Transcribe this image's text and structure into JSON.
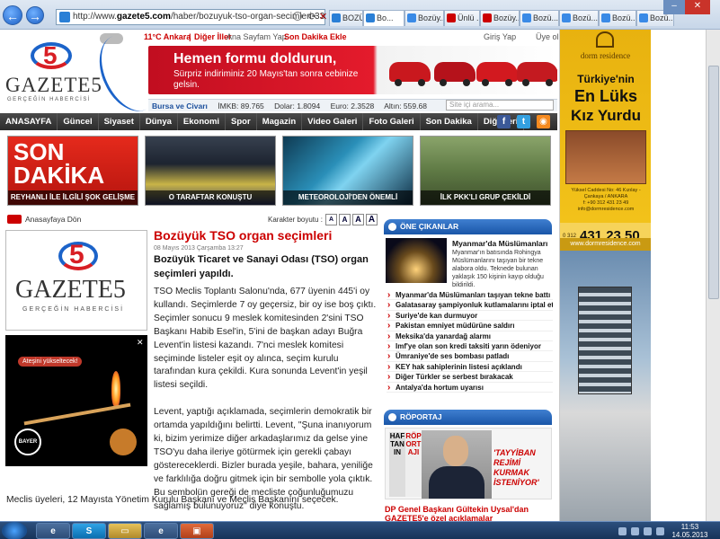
{
  "browser": {
    "url_prefix": "http://www.",
    "url_domain": "gazete5.com",
    "url_path": "/haber/bozuyuk-tso-organ-secimleri-330603.h",
    "tabs": [
      "BOZÜ...",
      "Bo...",
      "Bozüy...",
      "Ünlü ...",
      "Bozüy...",
      "Bozü...",
      "Bozü...",
      "Bozü...",
      "Bozü..."
    ],
    "nav_back_icon": "arrow-left-icon",
    "nav_forward_icon": "arrow-right-icon"
  },
  "topbar": {
    "weather": "11°C Ankara",
    "other_cities": "Diğer İller",
    "home_link": "Ana Sayfam Yap",
    "add_breaking": "Son Dakika Ekle",
    "login": "Giriş Yap",
    "register": "Üye ol"
  },
  "logo": {
    "number": "5",
    "name": "GAZETE5",
    "slogan": "GERÇEĞİN HABERCİSİ"
  },
  "banner": {
    "headline": "Hemen formu doldurun,",
    "subline": "Sürpriz indiriminiz 20 Mayıs'tan sonra cebinize gelsin."
  },
  "markets": {
    "weather_label": "Bursa ve Civarı",
    "imkb": "İMKB: 89.765",
    "dolar": "Dolar: 1.8094",
    "euro": "Euro: 2.3528",
    "altin": "Altın: 559.68",
    "search_placeholder": "Site içi arama..."
  },
  "nav": {
    "items": [
      "ANASAYFA",
      "Güncel",
      "Siyaset",
      "Dünya",
      "Ekonomi",
      "Spor",
      "Magazin",
      "Video Galeri",
      "Foto Galeri",
      "Son Dakika",
      "Diğerleri"
    ]
  },
  "headlines": [
    {
      "caption": "REYHANLI İLE İLGİLİ ŞOK GELİŞME",
      "big": "SON DAKİKA"
    },
    {
      "caption": "O TARAFTAR KONUŞTU"
    },
    {
      "caption": "METEOROLOJİ'DEN ÖNEMLİ"
    },
    {
      "caption": "İLK PKK'LI GRUP ÇEKİLDİ"
    }
  ],
  "article": {
    "back_label": "Anasayfaya Dön",
    "font_size_label": "Karakter boyutu :",
    "font_sizes": [
      "A",
      "A",
      "A",
      "A"
    ],
    "title": "Bozüyük TSO organ seçimleri",
    "date": "08 Mayıs 2013 Çarşamba 13:27",
    "lead": "Bozüyük Ticaret ve Sanayi Odası (TSO) organ seçimleri yapıldı.",
    "p1": "TSO Meclis Toplantı Salonu'nda, 677 üyenin 445'i oy kullandı. Seçimlerde 7 oy geçersiz, bir oy ise boş çıktı. Seçimler sonucu 9 meslek komitesinden 2'sini TSO Başkanı Habib Esel'in, 5'ini de başkan adayı Buğra Levent'in listesi kazandı. 7'nci meslek komitesi seçiminde listeler eşit oy alınca, seçim kurulu tarafından kura çekildi. Kura sonunda Levent'in yeşil listesi seçildi.",
    "p2": "Levent, yaptığı açıklamada, seçimlerin demokratik bir ortamda yapıldığını belirtti. Levent, \"Şuna inanıyorum ki, bizim yerimize diğer arkadaşlarımız da gelse yine TSO'yu daha ileriye götürmek için gerekli çabayı göstereceklerdi. Bizler burada yeşile, bahara, yeniliğe ve farklılığa doğru gitmek için bir sembolle yola çıktık. Bu sembolün gereği de mecliste çoğunluğumuzu sağlamış bulunuyoruz\" diye konuştu.",
    "p3": "Meclis üyeleri, 12 Mayısta Yönetim Kurulu Başkanı ve Meclis Başkanını seçecek."
  },
  "ad_left": {
    "badge": "Ateşini yükseltecek!",
    "brand": "BAYER"
  },
  "one_cikanlar": {
    "header": "ÖNE ÇIKANLAR",
    "feature_title": "Myanmar'da Müslümanları",
    "feature_desc": "Myanmar'ın batısında Rohingya Müslümanlarını taşıyan bir tekne alabora oldu. Teknede bulunan yaklaşık 150 kişinin kayıp olduğu bildirildi.",
    "items": [
      "Myanmar'da Müslümanları taşıyan tekne battı",
      "Galatasaray şampiyonluk kutlamalarını iptal etti",
      "Suriye'de kan durmuyor",
      "Pakistan emniyet müdürüne saldırı",
      "Meksika'da yanardağ alarmı",
      "Imf'ye olan son kredi taksiti yarın ödeniyor",
      "Ümraniye'de ses bombası patladı",
      "KEY hak sahiplerinin listesi açıklandı",
      "Diğer Türkler se serbest bırakacak",
      "Antalya'da hortum uyarısı"
    ]
  },
  "roportaj": {
    "header": "RÖPORTAJ",
    "vertical_a": "HAFTANIN",
    "vertical_b": "RÖPORTAJI",
    "quote": "'TAYYİBAN REJİMİ KURMAK İSTENİYOR'",
    "caption": "DP Genel Başkanı Gültekin Uysal'dan GAZETE5'e özel açıklamalar"
  },
  "side_ad": {
    "brand": "dorm residence",
    "line1": "Türkiye'nin",
    "line2": "En Lüks",
    "line3": "Kız Yurdu",
    "address": "Yüksel Caddesi No: 46 Kızılay - Çankaya / ANKARA",
    "fax": "f: +90 312 431 23 49",
    "email": "info@dormresidence.com",
    "phone_prefix": "0 312",
    "phone": "431 23 50",
    "web": "www.dormresidence.com"
  },
  "taskbar": {
    "time": "11:53",
    "date": "14.05.2013"
  }
}
